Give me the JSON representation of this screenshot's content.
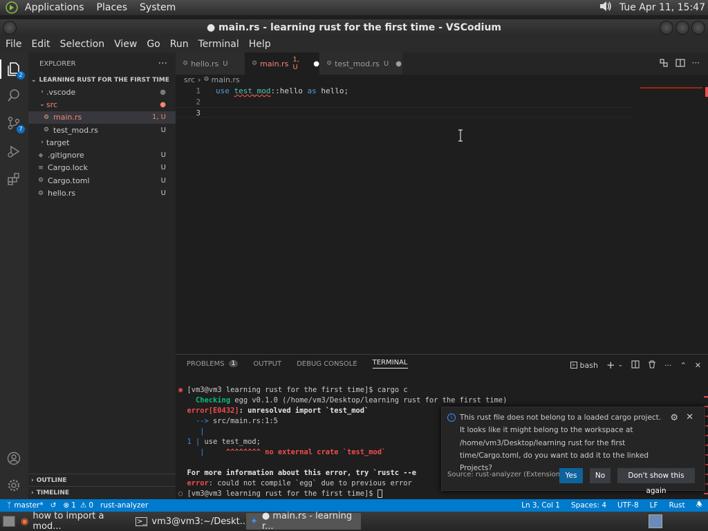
{
  "system_panel": {
    "menus": [
      "Applications",
      "Places",
      "System"
    ],
    "clock": "Tue Apr 11, 15:47"
  },
  "window": {
    "title": "● main.rs - learning rust for the first time - VSCodium"
  },
  "menubar": [
    "File",
    "Edit",
    "Selection",
    "View",
    "Go",
    "Run",
    "Terminal",
    "Help"
  ],
  "activity_bar": {
    "explorer_badge": "2",
    "scm_badge": "7"
  },
  "sidebar": {
    "title": "EXPLORER",
    "more": "···",
    "folder": "LEARNING RUST FOR THE FIRST TIME",
    "tree": [
      {
        "name": ".vscode",
        "status": "●"
      },
      {
        "name": "src",
        "status": "●"
      },
      {
        "name": "main.rs",
        "status": "1, U"
      },
      {
        "name": "test_mod.rs",
        "status": "U"
      },
      {
        "name": "target",
        "status": ""
      },
      {
        "name": ".gitignore",
        "status": "U"
      },
      {
        "name": "Cargo.lock",
        "status": "U"
      },
      {
        "name": "Cargo.toml",
        "status": "U"
      },
      {
        "name": "hello.rs",
        "status": "U"
      }
    ],
    "outline": "OUTLINE",
    "timeline": "TIMELINE"
  },
  "tabs": [
    {
      "label": "hello.rs",
      "status": "U"
    },
    {
      "label": "main.rs",
      "status": "1, U",
      "dirty": "●"
    },
    {
      "label": "test_mod.rs",
      "status": "U",
      "dirty": "●"
    }
  ],
  "breadcrumb": {
    "folder": "src",
    "sep": "›",
    "file": "main.rs"
  },
  "editor": {
    "lines": [
      {
        "n": "1",
        "kw1": "use",
        "mod": "test_mod",
        "rest": "::hello ",
        "kw2": "as",
        "alias": " hello;"
      },
      {
        "n": "2"
      },
      {
        "n": "3"
      }
    ]
  },
  "panel": {
    "tabs": [
      "PROBLEMS",
      "OUTPUT",
      "DEBUG CONSOLE",
      "TERMINAL"
    ],
    "problems_count": "1",
    "shell": "bash"
  },
  "terminal": {
    "l1_prompt": "[vm3@vm3 learning rust for the first time]$ cargo c",
    "l2_kw": "    Checking",
    "l2_rest": " egg v0.1.0 (/home/vm3/Desktop/learning rust for the first time)",
    "l3_kw": "error[E0432]",
    "l3_rest": ": unresolved import `test_mod`",
    "l4_arrow": "  -->",
    "l4_rest": " src/main.rs:1:5",
    "l5_bar": "   |",
    "l6_num": "1",
    "l6_bar": " |",
    "l6_rest": " use test_mod;",
    "l7_bar": "   |",
    "l7_err": "     ^^^^^^^^ no external crate `test_mod`",
    "l8": "For more information about this error, try `rustc --e",
    "l9_kw": "error",
    "l9_rest": ": could not compile `egg` due to previous error",
    "l10_prompt": "[vm3@vm3 learning rust for the first time]$ "
  },
  "notification": {
    "message": "This rust file does not belong to a loaded cargo project. It looks like it might belong to the workspace at /home/vm3/Desktop/learning rust for the first time/Cargo.toml, do you want to add it to the linked Projects?",
    "source": "Source: rust-analyzer (Extension)",
    "yes": "Yes",
    "no": "No",
    "dont_show": "Don't show this again"
  },
  "statusbar": {
    "branch": "master*",
    "errors": "1",
    "warnings": "0",
    "extension": "rust-analyzer",
    "position": "Ln 3, Col 1",
    "spaces": "Spaces: 4",
    "encoding": "UTF-8",
    "eol": "LF",
    "language": "Rust"
  },
  "taskbar": [
    "how to import a mod...",
    "vm3@vm3:~/Deskt...",
    "● main.rs - learning r..."
  ],
  "colors": {
    "accent": "#007acc",
    "error": "#f48771",
    "terminal_green": "#0dbc79",
    "terminal_red": "#f14c4c"
  }
}
